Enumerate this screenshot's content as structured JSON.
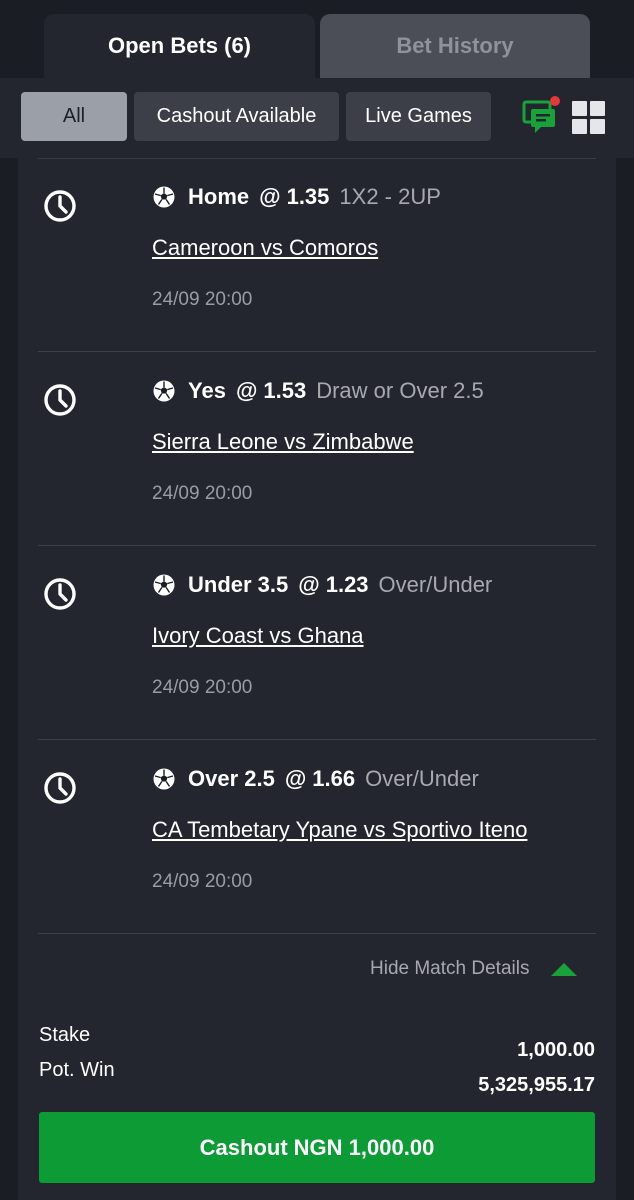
{
  "tabs": {
    "open_bets": "Open Bets (6)",
    "bet_history": "Bet History"
  },
  "filters": {
    "all": "All",
    "cashout_available": "Cashout Available",
    "live_games": "Live Games"
  },
  "icons": {
    "chat": "chat-notification-icon",
    "grid": "grid-view-icon",
    "clock": "clock-icon",
    "ball": "soccer-ball-icon",
    "toggle": "triangle-up-icon"
  },
  "colors": {
    "accent": "#0c9b35",
    "notification": "#e53935"
  },
  "bets": [
    {
      "pick": "Home",
      "at": "@",
      "odds": "1.35",
      "market": "1X2 - 2UP",
      "match": "Cameroon vs Comoros",
      "datetime": "24/09 20:00"
    },
    {
      "pick": "Yes",
      "at": "@",
      "odds": "1.53",
      "market": "Draw or Over 2.5",
      "match": "Sierra Leone vs Zimbabwe",
      "datetime": "24/09 20:00"
    },
    {
      "pick": "Under 3.5",
      "at": "@",
      "odds": "1.23",
      "market": "Over/Under",
      "match": "Ivory Coast vs Ghana",
      "datetime": "24/09 20:00"
    },
    {
      "pick": "Over 2.5",
      "at": "@",
      "odds": "1.66",
      "market": "Over/Under",
      "match": "CA Tembetary Ypane vs Sportivo Iteno",
      "datetime": "24/09 20:00"
    }
  ],
  "details_toggle": "Hide Match Details",
  "summary": {
    "stake_label": "Stake",
    "potwin_label": "Pot. Win",
    "stake_value": "1,000.00",
    "potwin_value": "5,325,955.17"
  },
  "cashout": {
    "label": "Cashout",
    "amount": "NGN 1,000.00"
  }
}
